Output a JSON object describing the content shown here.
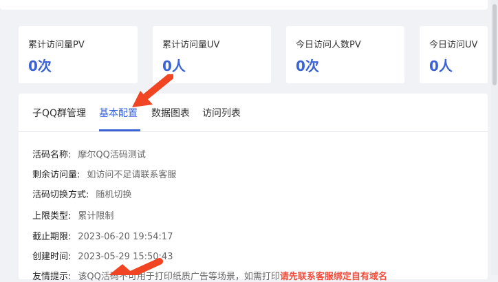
{
  "stats": [
    {
      "label": "累计访问量PV",
      "value": "0次"
    },
    {
      "label": "累计访问量UV",
      "value": "0人"
    },
    {
      "label": "今日访问人数PV",
      "value": "0次"
    },
    {
      "label": "今日访问UV",
      "value": "0人"
    }
  ],
  "tabs": {
    "qq_group": "子QQ群管理",
    "basic_config": "基本配置",
    "data_chart": "数据图表",
    "visit_list": "访问列表",
    "active": "基本配置"
  },
  "details": {
    "code_name": {
      "label": "活码名称:",
      "value": "摩尔QQ活码测试"
    },
    "remaining_visits": {
      "label": "剩余访问量:",
      "value": "如访问不足请联系客服"
    },
    "switch_mode": {
      "label": "活码切换方式:",
      "value": "随机切换"
    },
    "limit_type": {
      "label": "上限类型:",
      "value": "累计限制"
    },
    "deadline": {
      "label": "截止期限:",
      "value": "2023-06-20 19:54:17"
    },
    "created_time": {
      "label": "创建时间:",
      "value": "2023-05-29 15:50:43"
    },
    "tip": {
      "label": "友情提示:",
      "value": "该QQ活码不可用于打印纸质广告等场景，如需打印",
      "warning": "请先联系客服绑定自有域名"
    }
  },
  "colors": {
    "accent": "#3a63d8",
    "annotation_arrow": "#f04423",
    "warning": "#f04c3c"
  }
}
